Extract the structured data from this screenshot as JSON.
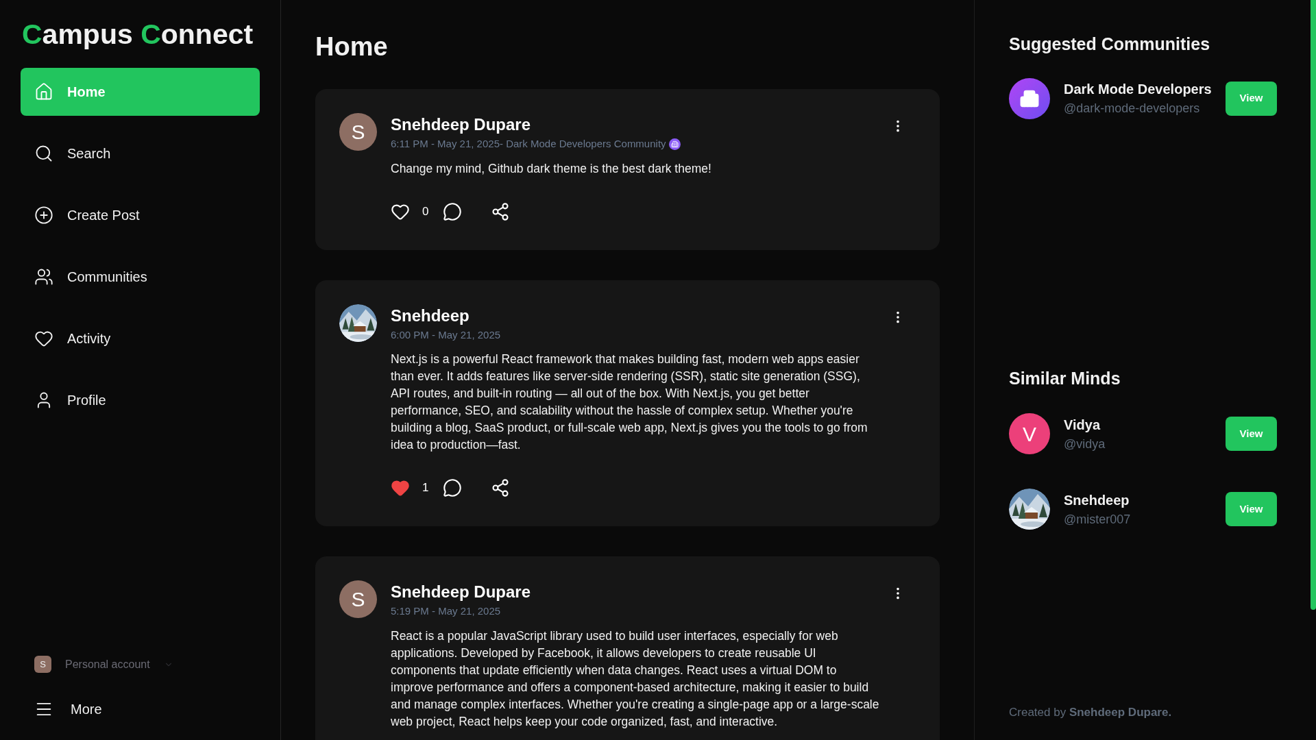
{
  "logo": [
    {
      "text": "C",
      "accent": true
    },
    {
      "text": "ampus ",
      "accent": false
    },
    {
      "text": "C",
      "accent": true
    },
    {
      "text": "onnect",
      "accent": false
    }
  ],
  "nav": [
    {
      "label": "Home",
      "kind": "home",
      "selected": true
    },
    {
      "label": "Search",
      "kind": "search",
      "selected": false
    },
    {
      "label": "Create Post",
      "kind": "create",
      "selected": false
    },
    {
      "label": "Communities",
      "kind": "communities",
      "selected": false
    },
    {
      "label": "Activity",
      "kind": "activity",
      "selected": false
    },
    {
      "label": "Profile",
      "kind": "profile",
      "selected": false
    }
  ],
  "account": {
    "initial": "S",
    "label": "Personal account",
    "color": "#8d6e63"
  },
  "more": {
    "label": "More"
  },
  "page_title": "Home",
  "posts": [
    {
      "author": "Snehdeep Dupare",
      "avatar": {
        "kind": "letter",
        "initial": "S",
        "color": "#8d6e63"
      },
      "meta": "6:11 PM - May 21, 2025- Dark Mode Developers Community",
      "community_badge": true,
      "body": "Change my mind, Github dark theme is the best dark theme!",
      "liked": false,
      "likes": "0"
    },
    {
      "author": "Snehdeep",
      "meta": "6:00 PM - May 21, 2025",
      "community_badge": false,
      "body": "Next.js is a powerful React framework that makes building fast, modern web apps easier than ever. It adds features like server-side rendering (SSR), static site generation (SSG), API routes, and built-in routing — all out of the box. With Next.js, you get better performance, SEO, and scalability without the hassle of complex setup. Whether you're building a blog, SaaS product, or full-scale web app, Next.js gives you the tools to go from idea to production—fast.",
      "liked": true,
      "likes": "1"
    },
    {
      "author": "Snehdeep Dupare",
      "avatar": {
        "kind": "letter",
        "initial": "S",
        "color": "#8d6e63"
      },
      "meta": "5:19 PM - May 21, 2025",
      "community_badge": false,
      "body": "React is a popular JavaScript library used to build user interfaces, especially for web applications. Developed by Facebook, it allows developers to create reusable UI components that update efficiently when data changes. React uses a virtual DOM to improve performance and offers a component-based architecture, making it easier to build and manage complex interfaces. Whether you're creating a single-page app or a large-scale web project, React helps keep your code organized, fast, and interactive."
    }
  ],
  "suggested_communities": {
    "title": "Suggested Communities",
    "items": [
      {
        "name": "Dark Mode Developers",
        "handle": "@dark-mode-developers",
        "avatar": {
          "kind": "icon"
        },
        "button": "View"
      }
    ]
  },
  "similar_minds": {
    "title": "Similar Minds",
    "items": [
      {
        "name": "Vidya",
        "handle": "@vidya",
        "avatar": {
          "kind": "letter",
          "initial": "V",
          "color": "#ec407a"
        },
        "button": "View"
      },
      {
        "name": "Snehdeep",
        "handle": "@mister007",
        "button": "View"
      }
    ]
  },
  "footer": "Created by **Snehdeep Dupare.**"
}
